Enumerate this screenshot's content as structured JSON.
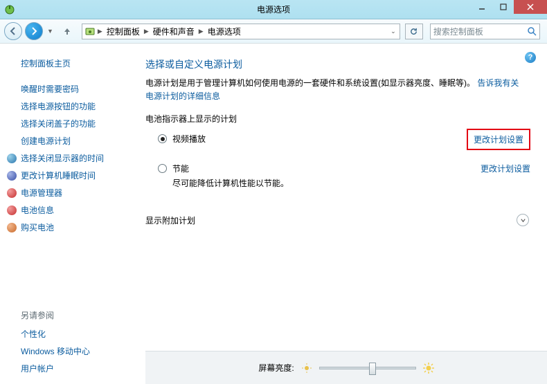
{
  "window": {
    "title": "电源选项"
  },
  "breadcrumbs": {
    "root_icon": "control-panel-icon",
    "item1": "控制面板",
    "item2": "硬件和声音",
    "item3": "电源选项"
  },
  "search": {
    "placeholder": "搜索控制面板"
  },
  "sidebar": {
    "home": "控制面板主页",
    "links": [
      "唤醒时需要密码",
      "选择电源按钮的功能",
      "选择关闭盖子的功能",
      "创建电源计划"
    ],
    "icon_links": [
      "选择关闭显示器的时间",
      "更改计算机睡眠时间",
      "电源管理器",
      "电池信息",
      "购买电池"
    ],
    "see_also_header": "另请参阅",
    "see_also": [
      "个性化",
      "Windows 移动中心",
      "用户帐户"
    ]
  },
  "main": {
    "title": "选择或自定义电源计划",
    "desc_pre": "电源计划是用于管理计算机如何使用电源的一套硬件和系统设置(如显示器亮度、睡眠等)。",
    "desc_link": "告诉我有关电源计划的详细信息",
    "section_shown": "电池指示器上显示的计划",
    "plan1": {
      "name": "视频播放",
      "change": "更改计划设置"
    },
    "plan2": {
      "name": "节能",
      "note": "尽可能降低计算机性能以节能。",
      "change": "更改计划设置"
    },
    "section_extra": "显示附加计划"
  },
  "bottom": {
    "brightness_label": "屏幕亮度:",
    "slider_percent": 55
  }
}
